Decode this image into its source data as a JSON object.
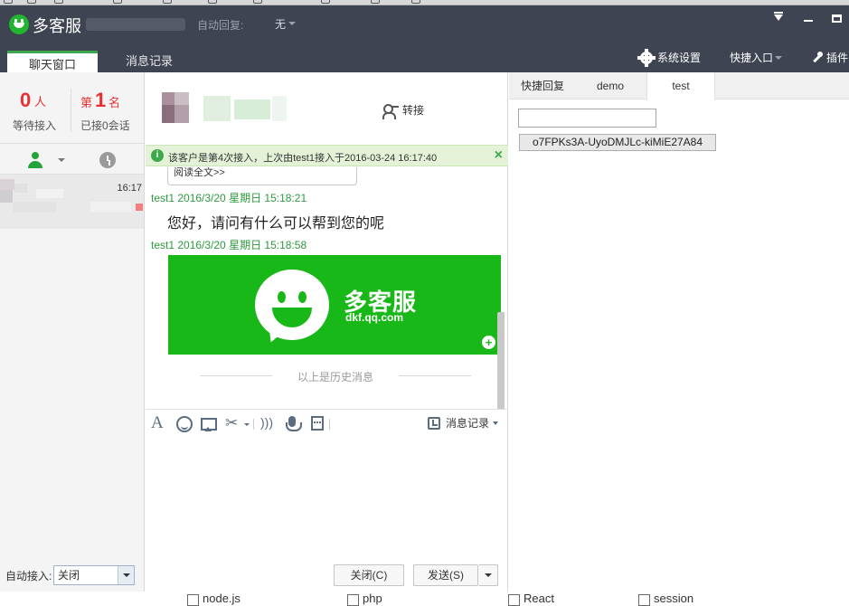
{
  "app": {
    "name": "多客服",
    "auto_reply_label": "自动回复:",
    "auto_reply_value": "无"
  },
  "tabs": {
    "chat": "聊天窗口",
    "history": "消息记录"
  },
  "header_right": {
    "settings": "系统设置",
    "quick_entry": "快捷入口",
    "plugins": "插件"
  },
  "stats": {
    "waiting_count": "0",
    "waiting_unit": "人",
    "waiting_label": "等待接入",
    "rank_prefix": "第",
    "rank_number": "1",
    "rank_suffix": "名",
    "rank_label": "已接0会话"
  },
  "session": {
    "time": "16:17"
  },
  "auto_accept": {
    "label": "自动接入:",
    "value": "关闭"
  },
  "conversation": {
    "transfer_label": "转接",
    "notice": "该客户是第4次接入，上次由test1接入于2016-03-24 16:17:40",
    "history_card_snippet": "阅读全文>>",
    "messages": [
      {
        "meta": "test1 2016/3/20 星期日 15:18:21",
        "text": "您好，请问有什么可以帮到您的呢"
      },
      {
        "meta": "test1 2016/3/20 星期日 15:18:58",
        "image_title": "多客服",
        "image_url_text": "dkf.qq.com"
      }
    ],
    "history_separator": "以上是历史消息",
    "toolbar": {
      "msg_log": "消息记录"
    },
    "close_button": "关闭(C)",
    "send_button": "发送(S)"
  },
  "right_panel": {
    "tabs": [
      "快捷回复",
      "demo",
      "test"
    ],
    "input_value": "",
    "openid_button": "o7FPKs3A-UyoDMJLc-kiMiE27A84"
  },
  "bottom_tags": [
    "node.js",
    "php",
    "React",
    "session"
  ],
  "colors": {
    "titlebar": "#3e4451",
    "accent_green": "#3ea84d",
    "alert_red": "#e83030",
    "brand_image_green": "#18b818"
  }
}
